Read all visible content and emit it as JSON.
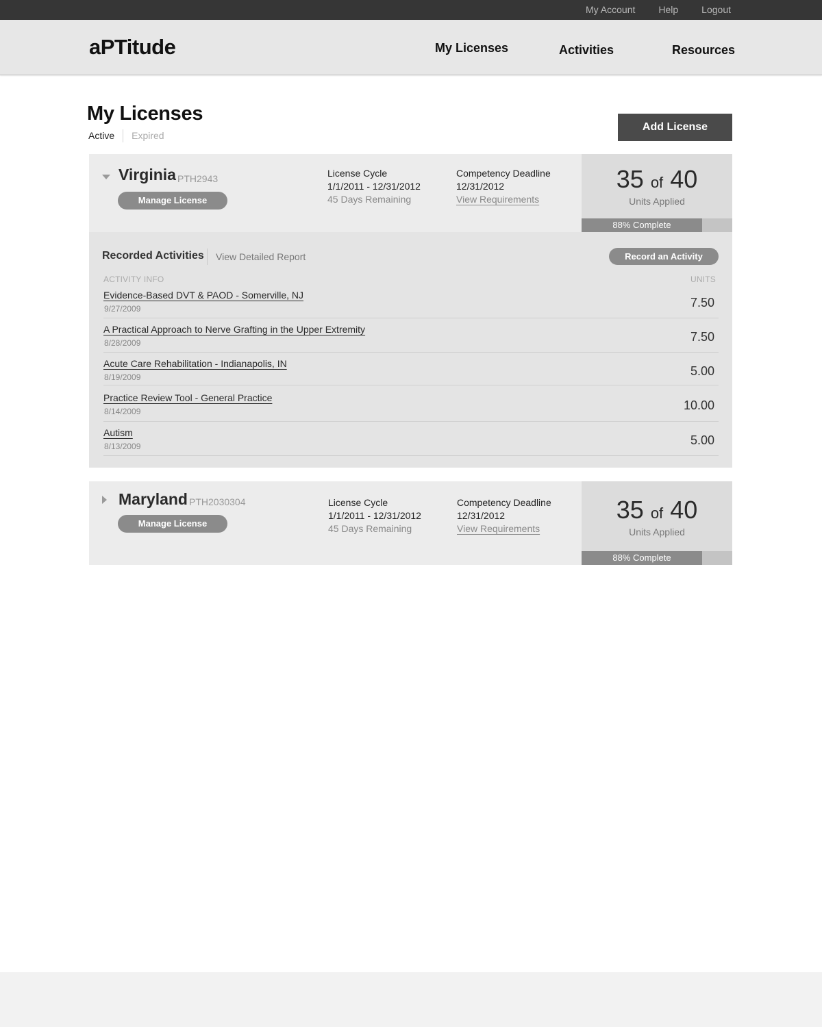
{
  "topbar": {
    "links": [
      "My Account",
      "Help",
      "Logout"
    ]
  },
  "brand": {
    "logo": "aPTitude"
  },
  "nav": {
    "items": [
      "My Licenses",
      "Activities",
      "Resources"
    ]
  },
  "page": {
    "title": "My Licenses",
    "tabs": [
      "Active",
      "Expired"
    ],
    "add_license_label": "Add License"
  },
  "licenses": [
    {
      "state": "Virginia",
      "license_number": "PTH2943",
      "expanded": true,
      "manage_label": "Manage License",
      "cycle_label": "License Cycle",
      "cycle_dates": "1/1/2011 - 12/31/2012",
      "days_remaining": "45 Days Remaining",
      "deadline_label": "Competency Deadline",
      "deadline_date": "12/31/2012",
      "requirements_link": "View Requirements",
      "units_applied": "35",
      "units_of": "of",
      "units_total": "40",
      "units_label": "Units Applied",
      "progress_fraction": 0.8,
      "progress_text": "88% Complete"
    },
    {
      "state": "Maryland",
      "license_number": "PTH2030304",
      "expanded": false,
      "manage_label": "Manage License",
      "cycle_label": "License Cycle",
      "cycle_dates": "1/1/2011 - 12/31/2012",
      "days_remaining": "45 Days Remaining",
      "deadline_label": "Competency Deadline",
      "deadline_date": "12/31/2012",
      "requirements_link": "View Requirements",
      "units_applied": "35",
      "units_of": "of",
      "units_total": "40",
      "units_label": "Units Applied",
      "progress_fraction": 0.8,
      "progress_text": "88% Complete"
    }
  ],
  "activities": {
    "title": "Recorded Activities",
    "report_link": "View Detailed Report",
    "record_label": "Record an Activity",
    "columns": {
      "info": "ACTIVITY INFO",
      "units": "UNITS"
    },
    "rows": [
      {
        "title": "Evidence-Based DVT & PAOD - Somerville, NJ",
        "date": "9/27/2009",
        "units": "7.50"
      },
      {
        "title": "A Practical Approach to Nerve Grafting in the Upper Extremity",
        "date": "8/28/2009",
        "units": "7.50"
      },
      {
        "title": "Acute Care Rehabilitation - Indianapolis, IN",
        "date": "8/19/2009",
        "units": "5.00"
      },
      {
        "title": "Practice Review Tool - General Practice",
        "date": "8/14/2009",
        "units": "10.00"
      },
      {
        "title": "Autism",
        "date": "8/13/2009",
        "units": "5.00"
      }
    ]
  }
}
